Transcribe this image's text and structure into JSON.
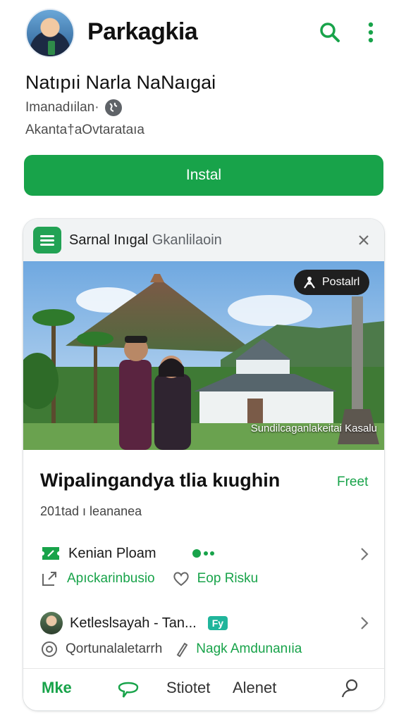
{
  "header": {
    "app_title": "Parkagkia",
    "search_icon": "search-icon",
    "menu_icon": "more-vertical-icon",
    "accent": "#18a34a"
  },
  "publisher": {
    "name": "Natıpıi Narla NaNaıgai",
    "line1": "Imanadıilan·",
    "line2": "Akanta†aOvtarataıa"
  },
  "install": {
    "label": "Instal",
    "color": "#18a34a"
  },
  "card": {
    "head_title_bold": "Sarnal Inıgal",
    "head_title_light": "Gkanlilaoin",
    "badge": "Postalrl",
    "caption": "Sundilcaganlakeitai Kasalu",
    "title": "Wipalingandya tlia kıughin",
    "price": "Freet",
    "meta": "201tad ı leananea",
    "row1": {
      "main": "Kenian Ploam",
      "sub_a": "Apıckarinbusio",
      "sub_b": "Eop Risku"
    },
    "row2": {
      "main": "Ketleslsayah - Tan...",
      "chip": "Fy",
      "sub_a": "Qortunalaletarrh",
      "sub_b": "Nagk Amdunanıia"
    }
  },
  "tabs": [
    "Mke",
    "Stiotet",
    "Alenet"
  ]
}
